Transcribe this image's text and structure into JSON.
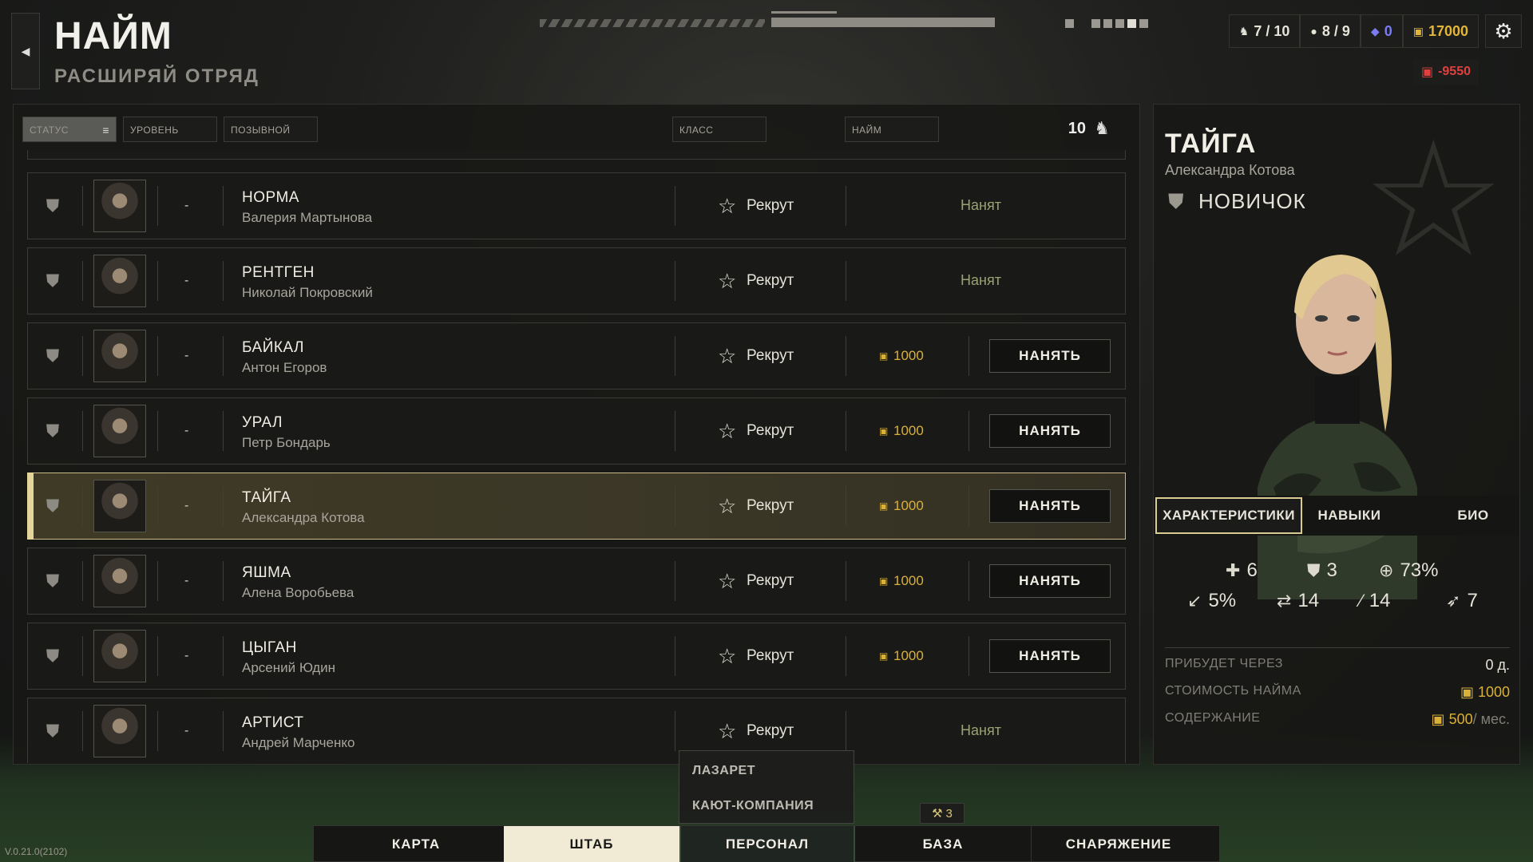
{
  "header": {
    "title": "НАЙМ",
    "subtitle": "РАСШИРЯЙ ОТРЯД",
    "back_icon": "chevron-left-icon"
  },
  "resources": {
    "recruits": "7 / 10",
    "soldiers": "8 / 9",
    "diamonds": "0",
    "money": "17000",
    "expense": "-9550"
  },
  "filters": {
    "status": "СТАТУС",
    "level": "УРОВЕНЬ",
    "callsign": "ПОЗЫВНОЙ",
    "class": "КЛАСС",
    "hire": "НАЙМ",
    "count": "10"
  },
  "recruits": [
    {
      "callsign": "НОРМА",
      "name": "Валерия Мартынова",
      "level": "-",
      "class": "Рекрут",
      "hired": true,
      "status": "Нанят",
      "price": "",
      "hire_label": ""
    },
    {
      "callsign": "РЕНТГЕН",
      "name": "Николай Покровский",
      "level": "-",
      "class": "Рекрут",
      "hired": true,
      "status": "Нанят",
      "price": "",
      "hire_label": ""
    },
    {
      "callsign": "БАЙКАЛ",
      "name": "Антон Егоров",
      "level": "-",
      "class": "Рекрут",
      "hired": false,
      "status": "",
      "price": "1000",
      "hire_label": "НАНЯТЬ"
    },
    {
      "callsign": "УРАЛ",
      "name": "Петр Бондарь",
      "level": "-",
      "class": "Рекрут",
      "hired": false,
      "status": "",
      "price": "1000",
      "hire_label": "НАНЯТЬ"
    },
    {
      "callsign": "ТАЙГА",
      "name": "Александра Котова",
      "level": "-",
      "class": "Рекрут",
      "hired": false,
      "status": "",
      "price": "1000",
      "hire_label": "НАНЯТЬ"
    },
    {
      "callsign": "ЯШМА",
      "name": "Алена Воробьева",
      "level": "-",
      "class": "Рекрут",
      "hired": false,
      "status": "",
      "price": "1000",
      "hire_label": "НАНЯТЬ"
    },
    {
      "callsign": "ЦЫГАН",
      "name": "Арсений Юдин",
      "level": "-",
      "class": "Рекрут",
      "hired": false,
      "status": "",
      "price": "1000",
      "hire_label": "НАНЯТЬ"
    },
    {
      "callsign": "АРТИСТ",
      "name": "Андрей Марченко",
      "level": "-",
      "class": "Рекрут",
      "hired": true,
      "status": "Нанят",
      "price": "",
      "hire_label": ""
    }
  ],
  "selected_index": 4,
  "detail": {
    "callsign": "ТАЙГА",
    "name": "Александра Котова",
    "rank": "НОВИЧОК",
    "tabs": [
      "ХАРАКТЕРИСТИКИ",
      "НАВЫКИ",
      "БИО"
    ],
    "stats": {
      "health": "6",
      "armor": "3",
      "accuracy": "73%",
      "crit": "5%",
      "evasion": "14",
      "melee": "14",
      "speed": "7"
    },
    "arrives_label": "ПРИБУДЕТ ЧЕРЕЗ",
    "arrives_value": "0 д.",
    "cost_label": "СТОИМОСТЬ НАЙМА",
    "cost_value": "1000",
    "upkeep_label": "СОДЕРЖАНИЕ",
    "upkeep_value": "500",
    "upkeep_unit": "/ мес."
  },
  "submenu": {
    "items": [
      "ЛАЗАРЕТ",
      "КАЮТ-КОМПАНИЯ"
    ]
  },
  "badge": "3",
  "nav": {
    "tabs": [
      "КАРТА",
      "ШТАБ",
      "ПЕРСОНАЛ",
      "БАЗА",
      "СНАРЯЖЕНИЕ"
    ],
    "active": "ШТАБ"
  },
  "version": "V.0.21.0(2102)",
  "colors": {
    "accent_gold": "#d9b03a",
    "hired_green": "#9aa370",
    "selected_border": "#c9b98a",
    "expense_red": "#e04040",
    "diamond_blue": "#7a7cf0"
  }
}
